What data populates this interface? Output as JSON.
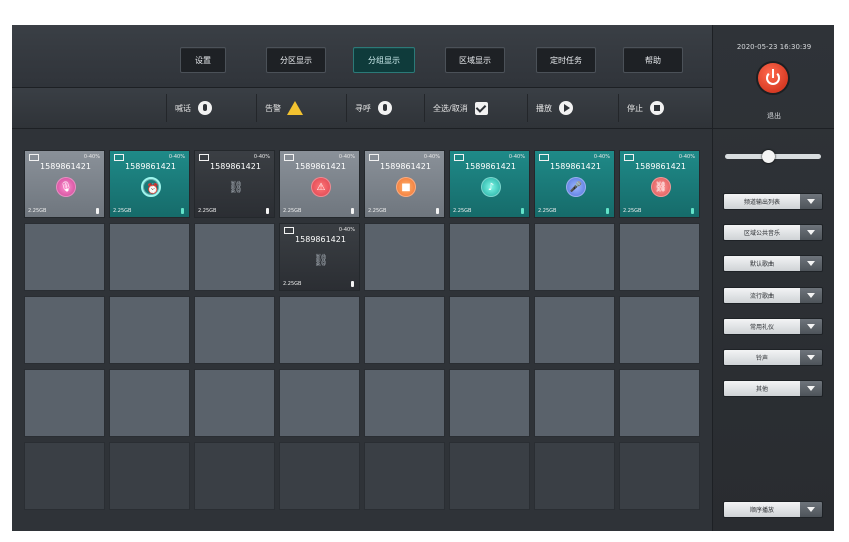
{
  "tabs": [
    {
      "label": "设置"
    },
    {
      "label": "分区显示"
    },
    {
      "label": "分组显示",
      "active": true
    },
    {
      "label": "区域显示"
    },
    {
      "label": "定时任务"
    },
    {
      "label": "帮助"
    }
  ],
  "controls": [
    {
      "label": "喊话",
      "icon": "mic-icon"
    },
    {
      "label": "告警",
      "icon": "warning-icon"
    },
    {
      "label": "寻呼",
      "icon": "pager-icon"
    },
    {
      "label": "全选/取消",
      "icon": "checkbox-icon"
    },
    {
      "label": "播放",
      "icon": "play-icon"
    },
    {
      "label": "停止",
      "icon": "stop-icon"
    }
  ],
  "right": {
    "datetime": "2020-05-23 16:30:39",
    "power_label": "退出",
    "volume_percent": 44,
    "menu_items": [
      {
        "label": "频道输出列表"
      },
      {
        "label": "区域公共音乐"
      },
      {
        "label": "默认歌曲"
      },
      {
        "label": "流行歌曲"
      },
      {
        "label": "常用礼仪"
      },
      {
        "label": "铃声"
      },
      {
        "label": "其他"
      }
    ],
    "bottom_button": {
      "label": "顺序播放"
    }
  },
  "cards": [
    {
      "number": "1589861421",
      "percent": "0-40%",
      "capacity": "2.25GB",
      "style": "gray",
      "badge": "pink",
      "glyph": "mic"
    },
    {
      "number": "1589861421",
      "percent": "0-40%",
      "capacity": "2.25GB",
      "style": "teal",
      "badge": "cyanring",
      "glyph": "clock"
    },
    {
      "number": "1589861421",
      "percent": "0-40%",
      "capacity": "2.25GB",
      "style": "black",
      "badge": "none",
      "glyph": "link"
    },
    {
      "number": "1589861421",
      "percent": "0-40%",
      "capacity": "2.25GB",
      "style": "gray",
      "badge": "red",
      "glyph": "warning"
    },
    {
      "number": "1589861421",
      "percent": "0-40%",
      "capacity": "2.25GB",
      "style": "gray",
      "badge": "orange",
      "glyph": "stop"
    },
    {
      "number": "1589861421",
      "percent": "0-40%",
      "capacity": "2.25GB",
      "style": "teal",
      "badge": "teal",
      "glyph": "note"
    },
    {
      "number": "1589861421",
      "percent": "0-40%",
      "capacity": "2.25GB",
      "style": "teal",
      "badge": "blue",
      "glyph": "mic2"
    },
    {
      "number": "1589861421",
      "percent": "0-40%",
      "capacity": "2.25GB",
      "style": "teal",
      "badge": "rose",
      "glyph": "link2"
    },
    {
      "number": "1589861421",
      "percent": "0-40%",
      "capacity": "2.25GB",
      "style": "black",
      "badge": "none",
      "glyph": "link"
    }
  ]
}
